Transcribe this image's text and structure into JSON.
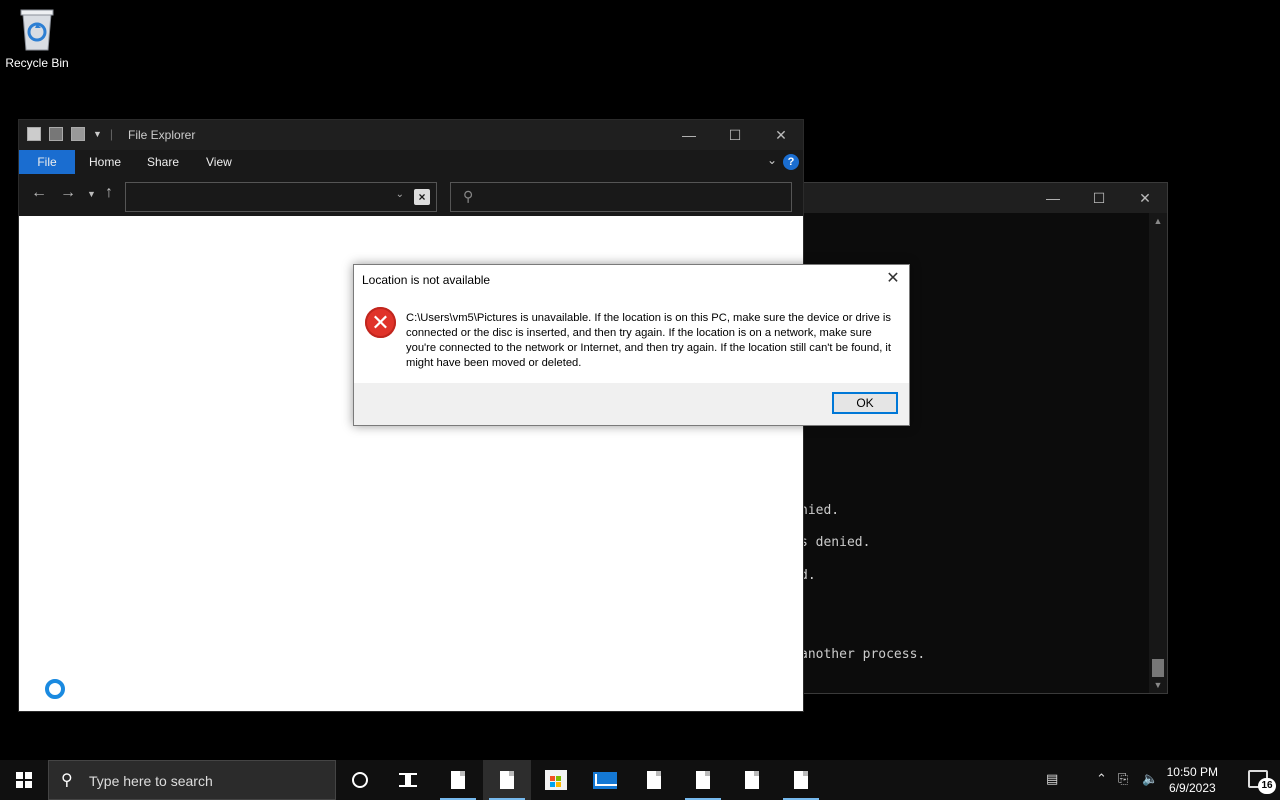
{
  "desktop": {
    "recycle_bin_label": "Recycle Bin"
  },
  "terminal": {
    "lines": [
      {
        "text": "nied."
      },
      {
        "text": "s denied."
      },
      {
        "text": "d."
      },
      {
        "text": "another process."
      }
    ]
  },
  "explorer": {
    "title": "File Explorer",
    "tabs": {
      "file": "File",
      "home": "Home",
      "share": "Share",
      "view": "View"
    },
    "help": "?",
    "address_value": "",
    "search_value": ""
  },
  "dialog": {
    "title": "Location is not available",
    "message": "C:\\Users\\vm5\\Pictures is unavailable. If the location is on this PC, make sure the device or drive is connected or the disc is inserted, and then try again. If the location is on a network, make sure you're connected to the network or Internet, and then try again. If the location still can't be found, it might have been moved or deleted.",
    "ok_label": "OK"
  },
  "taskbar": {
    "search_placeholder": "Type here to search",
    "time": "10:50 PM",
    "date": "6/9/2023",
    "notification_count": "16",
    "accent_color": "#76b9ed"
  }
}
